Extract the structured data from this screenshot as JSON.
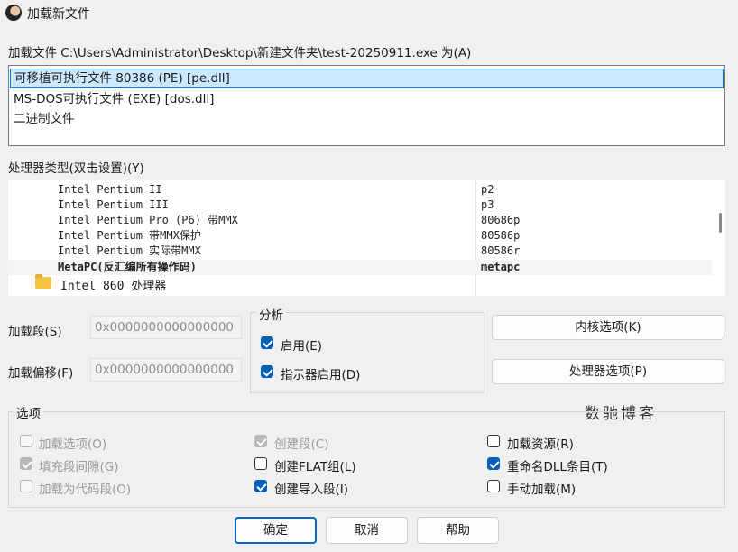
{
  "window": {
    "title": "加载新文件",
    "app_icon": "avatar-icon"
  },
  "file_prompt": "加载文件 C:\\Users\\Administrator\\Desktop\\新建文件夹\\test-20250911.exe 为(A)",
  "file_types": [
    {
      "label": "可移植可执行文件 80386 (PE) [pe.dll]",
      "selected": true
    },
    {
      "label": "MS-DOS可执行文件 (EXE) [dos.dll]",
      "selected": false
    },
    {
      "label": "二进制文件",
      "selected": false
    }
  ],
  "processor": {
    "label": "处理器类型(双击设置)(Y)",
    "rows": [
      {
        "name": "Intel Pentium II",
        "code": "p2"
      },
      {
        "name": "Intel Pentium III",
        "code": "p3"
      },
      {
        "name": "Intel Pentium Pro (P6) 带MMX",
        "code": "80686p"
      },
      {
        "name": "Intel Pentium 带MMX保护",
        "code": "80586p"
      },
      {
        "name": "Intel Pentium 实际带MMX",
        "code": "80586r"
      },
      {
        "name": "MetaPC(反汇编所有操作码)",
        "code": "metapc",
        "bold": true
      }
    ],
    "folder": "Intel 860 处理器",
    "folder_icon": "folder-icon"
  },
  "segment": {
    "load_label": "加载段(S)",
    "load_value": "0x0000000000000000",
    "offset_label": "加载偏移(F)",
    "offset_value": "0x0000000000000000"
  },
  "analysis": {
    "title": "分析",
    "enabled_label": "启用(E)",
    "enabled": true,
    "indicator_label": "指示器启用(D)",
    "indicator": true
  },
  "buttons": {
    "kernel": "内核选项(K)",
    "processor": "处理器选项(P)",
    "ok": "确定",
    "cancel": "取消",
    "help": "帮助"
  },
  "options": {
    "title": "选项",
    "items": [
      {
        "label": "加载选项(O)",
        "checked": false,
        "disabled": true
      },
      {
        "label": "填充段间隙(G)",
        "checked": true,
        "disabled": true
      },
      {
        "label": "加载为代码段(O)",
        "checked": false,
        "disabled": true
      },
      {
        "label": "创建段(C)",
        "checked": true,
        "disabled": true
      },
      {
        "label": "创建FLAT组(L)",
        "checked": false,
        "disabled": false
      },
      {
        "label": "创建导入段(I)",
        "checked": true,
        "disabled": false
      },
      {
        "label": "加载资源(R)",
        "checked": false,
        "disabled": false
      },
      {
        "label": "重命名DLL条目(T)",
        "checked": true,
        "disabled": false
      },
      {
        "label": "手动加载(M)",
        "checked": false,
        "disabled": false
      }
    ]
  },
  "watermark": "数驰博客"
}
